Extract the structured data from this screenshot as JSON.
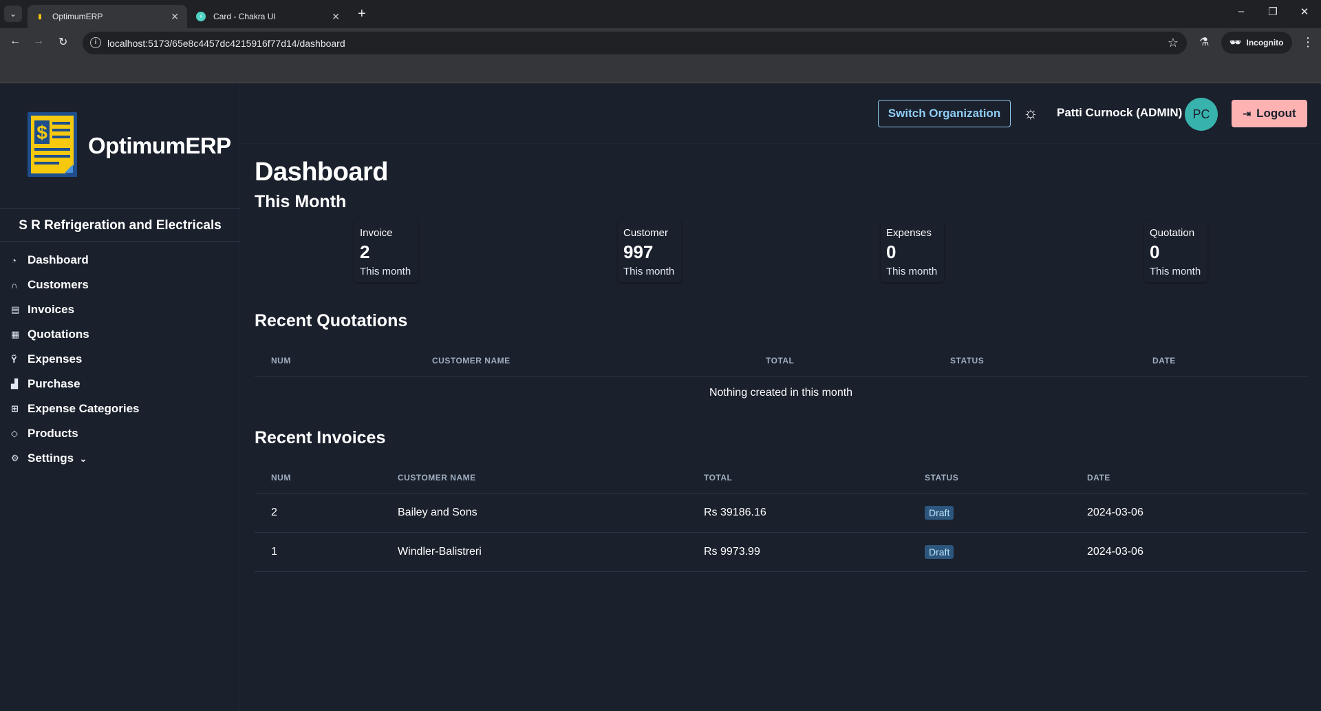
{
  "browser": {
    "tabs": [
      {
        "title": "OptimumERP",
        "active": true
      },
      {
        "title": "Card - Chakra UI",
        "active": false
      }
    ],
    "url": "localhost:5173/65e8c4457dc4215916f77d14/dashboard",
    "profile_label": "Incognito"
  },
  "sidebar": {
    "brand": "OptimumERP",
    "organization": "S R Refrigeration and Electricals",
    "items": [
      {
        "label": "Dashboard",
        "icon": "gauge-icon"
      },
      {
        "label": "Customers",
        "icon": "headphones-icon"
      },
      {
        "label": "Invoices",
        "icon": "file-invoice-icon"
      },
      {
        "label": "Quotations",
        "icon": "file-text-icon"
      },
      {
        "label": "Expenses",
        "icon": "expenses-icon"
      },
      {
        "label": "Purchase",
        "icon": "factory-icon"
      },
      {
        "label": "Expense Categories",
        "icon": "grid-icon"
      },
      {
        "label": "Products",
        "icon": "tag-icon"
      },
      {
        "label": "Settings",
        "icon": "gear-icon"
      }
    ]
  },
  "header": {
    "switch_org_label": "Switch Organization",
    "username": "Patti Curnock (ADMIN)",
    "avatar_initials": "PC",
    "logout_label": "Logout"
  },
  "dashboard": {
    "title": "Dashboard",
    "subtitle": "This Month",
    "stats": [
      {
        "label": "Invoice",
        "value": "2",
        "hint": "This month"
      },
      {
        "label": "Customer",
        "value": "997",
        "hint": "This month"
      },
      {
        "label": "Expenses",
        "value": "0",
        "hint": "This month"
      },
      {
        "label": "Quotation",
        "value": "0",
        "hint": "This month"
      }
    ],
    "recent_quotations": {
      "title": "Recent Quotations",
      "columns": [
        "NUM",
        "CUSTOMER NAME",
        "TOTAL",
        "STATUS",
        "DATE"
      ],
      "empty_text": "Nothing created in this month"
    },
    "recent_invoices": {
      "title": "Recent Invoices",
      "columns": [
        "NUM",
        "CUSTOMER NAME",
        "TOTAL",
        "STATUS",
        "DATE"
      ],
      "rows": [
        {
          "num": "2",
          "customer": "Bailey and Sons",
          "total": "Rs 39186.16",
          "status": "Draft",
          "date": "2024-03-06"
        },
        {
          "num": "1",
          "customer": "Windler-Balistreri",
          "total": "Rs 9973.99",
          "status": "Draft",
          "date": "2024-03-06"
        }
      ]
    }
  },
  "colors": {
    "background": "#1A202C",
    "accent_blue": "#90CDF4",
    "logout_bg": "#FEB2B2",
    "avatar_bg": "#38B2AC"
  }
}
